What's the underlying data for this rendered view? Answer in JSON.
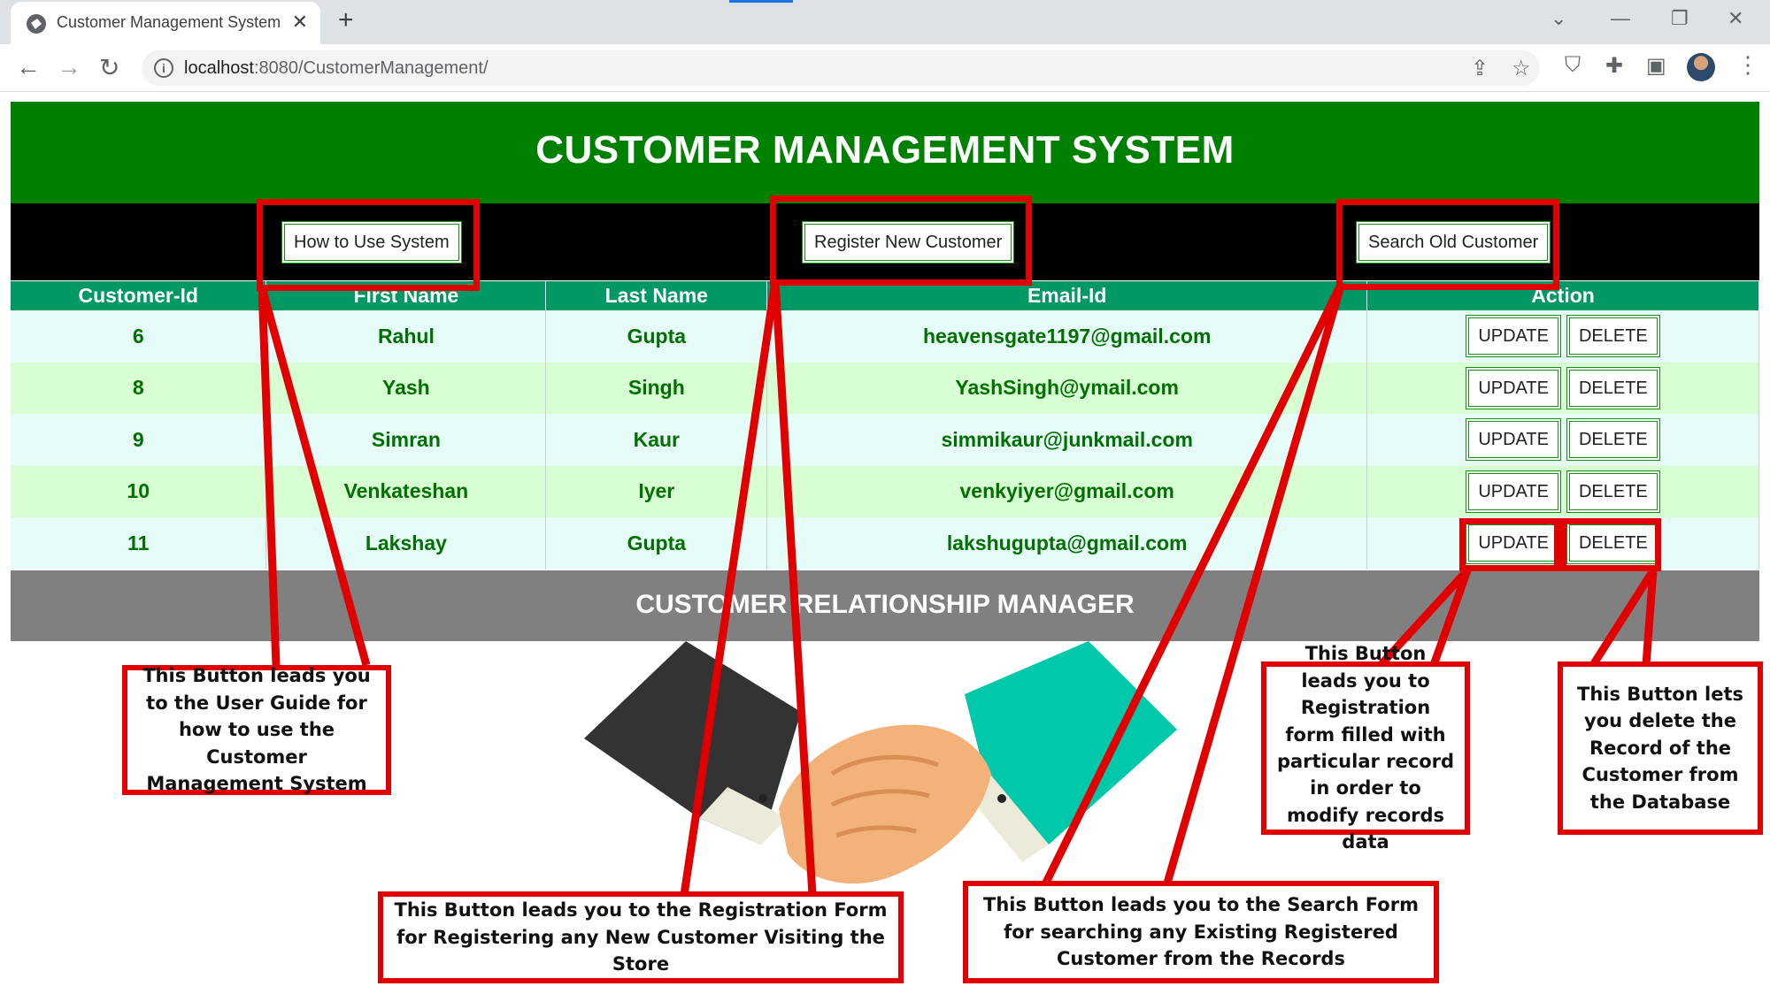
{
  "browser": {
    "tab_title": "Customer Management System",
    "url_host": "localhost",
    "url_rest": ":8080/CustomerManagement/"
  },
  "icons": {
    "tab_favicon": "globe-icon",
    "tab_close": "close-icon",
    "new_tab": "plus-icon",
    "back": "back-arrow-icon",
    "forward": "forward-arrow-icon",
    "reload": "reload-icon",
    "site_info": "info-icon",
    "share": "share-icon",
    "bookmark": "star-icon",
    "shield": "shield-icon",
    "extensions": "puzzle-icon",
    "side_panel": "side-panel-icon",
    "menu": "kebab-menu-icon"
  },
  "page": {
    "title": "CUSTOMER MANAGEMENT SYSTEM",
    "nav": {
      "how_to_use": "How to Use System",
      "register": "Register New Customer",
      "search": "Search Old Customer"
    },
    "table": {
      "columns": [
        "Customer-Id",
        "First Name",
        "Last Name",
        "Email-Id",
        "Action"
      ],
      "rows": [
        {
          "id": "6",
          "first": "Rahul",
          "last": "Gupta",
          "email": "heavensgate1197@gmail.com"
        },
        {
          "id": "8",
          "first": "Yash",
          "last": "Singh",
          "email": "YashSingh@ymail.com"
        },
        {
          "id": "9",
          "first": "Simran",
          "last": "Kaur",
          "email": "simmikaur@junkmail.com"
        },
        {
          "id": "10",
          "first": "Venkateshan",
          "last": "Iyer",
          "email": "venkyiyer@gmail.com"
        },
        {
          "id": "11",
          "first": "Lakshay",
          "last": "Gupta",
          "email": "lakshugupta@gmail.com"
        }
      ],
      "update_label": "UPDATE",
      "delete_label": "DELETE"
    },
    "footer": "CUSTOMER RELATIONSHIP MANAGER"
  },
  "annotations": {
    "how_to_use": "This Button leads you to the User Guide for how to use the Customer Management System",
    "register": "This Button leads you to the Registration Form for Registering any New Customer Visiting the Store",
    "search": "This Button leads you to the Search Form for searching any Existing Registered Customer from the Records",
    "update": "This Button leads you to Registration form filled with particular record in order to modify records data",
    "delete": "This Button lets you delete the Record of the Customer from the Database"
  },
  "colors": {
    "header_green": "#008000",
    "table_header": "#009966",
    "row_odd": "#e5fcf8",
    "row_even": "#d8ffd4",
    "cell_text": "#007000",
    "footer_gray": "#808080",
    "annotation_red": "#e00000"
  }
}
